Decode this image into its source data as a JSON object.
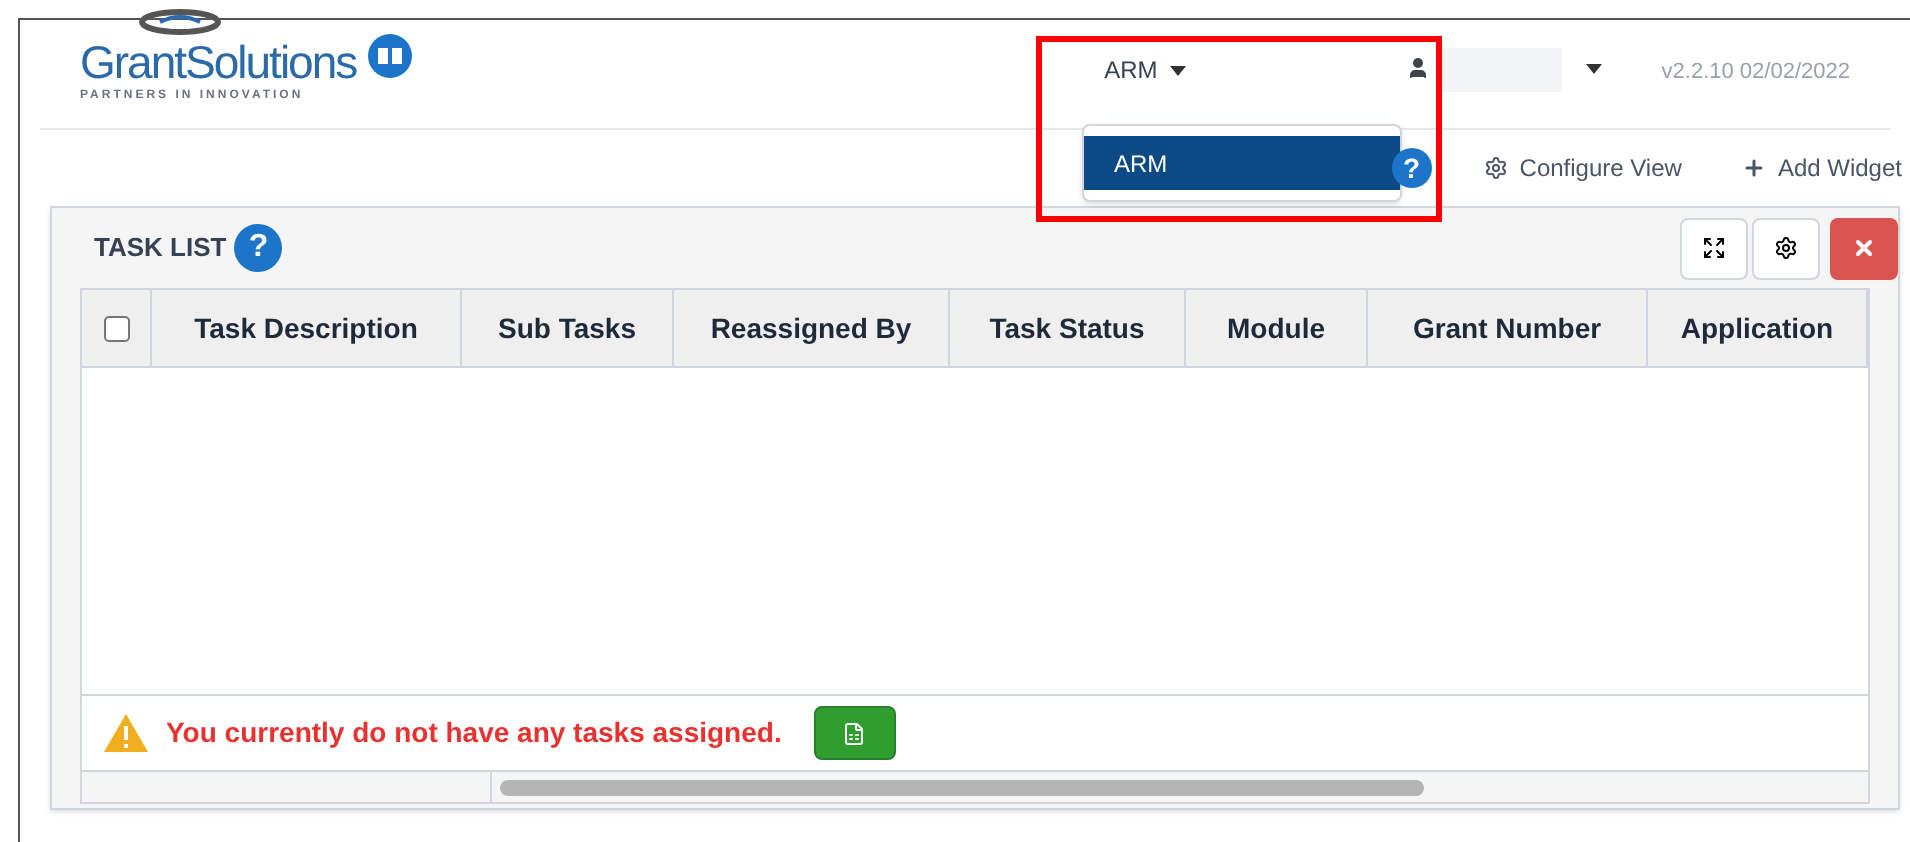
{
  "header": {
    "logo": {
      "name": "GrantSolutions",
      "tagline": "PARTNERS IN INNOVATION"
    },
    "module_menu": {
      "label": "ARM",
      "expanded": true,
      "items": [
        {
          "label": "ARM",
          "selected": true
        }
      ]
    },
    "version": "v2.2.10 02/02/2022"
  },
  "toolbar": {
    "help": "?",
    "actions": [
      {
        "kind": "gear",
        "label": "Configure View"
      },
      {
        "kind": "plus",
        "label": "Add Widget"
      }
    ]
  },
  "widget": {
    "title": "TASK LIST",
    "help": "?",
    "columns": [
      {
        "label": "Task Description"
      },
      {
        "label": "Sub Tasks"
      },
      {
        "label": "Reassigned By"
      },
      {
        "label": "Task Status"
      },
      {
        "label": "Module"
      },
      {
        "label": "Grant Number"
      },
      {
        "label": "Application"
      }
    ],
    "select_all": {
      "checked": false
    },
    "message": "You currently do not have any tasks assigned."
  }
}
